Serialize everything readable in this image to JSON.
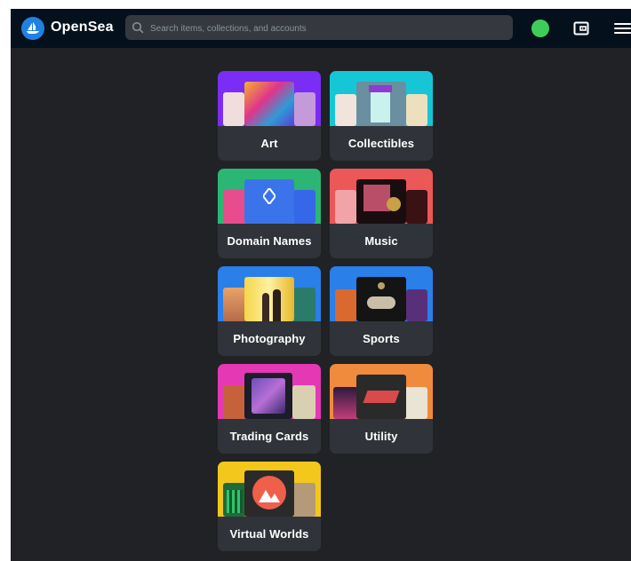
{
  "header": {
    "brand": "OpenSea",
    "search_placeholder": "Search items, collections, and accounts"
  },
  "categories": [
    {
      "label": "Art",
      "banner_color": "#7b2cf5"
    },
    {
      "label": "Collectibles",
      "banner_color": "#16c6d6"
    },
    {
      "label": "Domain Names",
      "banner_color": "#2bb673"
    },
    {
      "label": "Music",
      "banner_color": "#ec5757"
    },
    {
      "label": "Photography",
      "banner_color": "#2a7fe8"
    },
    {
      "label": "Sports",
      "banner_color": "#2a7fe8"
    },
    {
      "label": "Trading Cards",
      "banner_color": "#e538b5"
    },
    {
      "label": "Utility",
      "banner_color": "#f08a3c"
    },
    {
      "label": "Virtual Worlds",
      "banner_color": "#f3c71b"
    }
  ],
  "colors": {
    "nav_bg": "#04111d",
    "page_bg": "#202225",
    "card_bg": "#303339",
    "accent": "#2081e2",
    "avatar": "#3fcd5a"
  },
  "icons": [
    "opensea-logo-icon",
    "search-icon",
    "wallet-icon",
    "menu-icon"
  ]
}
